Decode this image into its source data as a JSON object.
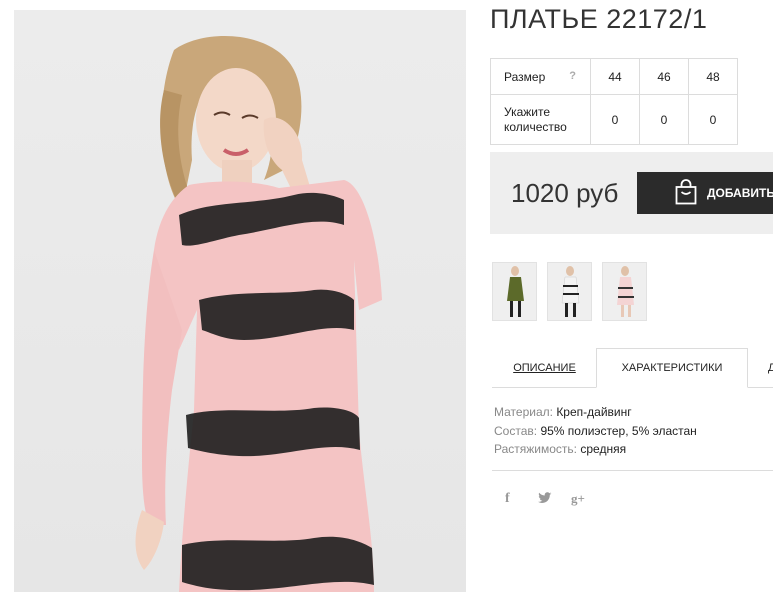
{
  "product": {
    "title": "ПЛАТЬЕ 22172/1",
    "price": "1020 руб",
    "add_label": "ДОБАВИТЬ"
  },
  "sizes": {
    "size_label": "Размер",
    "help": "?",
    "qty_label_line1": "Укажите",
    "qty_label_line2": "количество",
    "items": [
      {
        "size": "44",
        "qty": "0"
      },
      {
        "size": "46",
        "qty": "0"
      },
      {
        "size": "48",
        "qty": "0"
      }
    ]
  },
  "tabs": [
    {
      "label": "ОПИСАНИЕ"
    },
    {
      "label": "ХАРАКТЕРИСТИКИ"
    },
    {
      "label": "Д"
    }
  ],
  "specs": [
    {
      "key": "Материал:",
      "value": "Креп-дайвинг"
    },
    {
      "key": "Состав:",
      "value": "95% полиэстер, 5% эластан"
    },
    {
      "key": "Растяжимость:",
      "value": "средняя"
    }
  ],
  "social": {
    "facebook": "f",
    "twitter": "t",
    "gplus": "g+"
  },
  "icons": {
    "cart": "shopping-bag-icon"
  },
  "colors": {
    "dress": "#f4c4c4",
    "lace": "#1e1e1e",
    "button": "#2b2b2b",
    "price_bg": "#eeeeee"
  },
  "thumbnails": [
    "olive-dress",
    "white-dress",
    "pink-dress"
  ]
}
